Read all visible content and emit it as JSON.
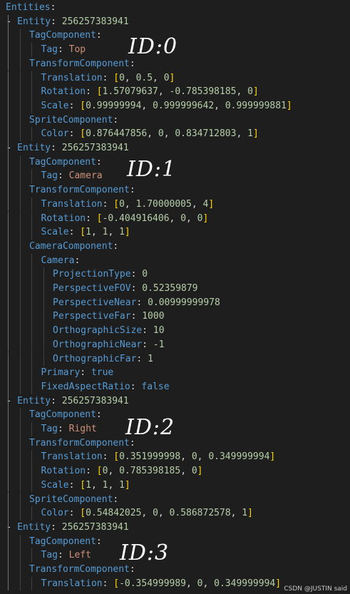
{
  "editor": {
    "lines": [
      {
        "indent": 0,
        "key": "Entities",
        "kind": "section"
      },
      {
        "indent": 1,
        "dash": true,
        "key": "Entity",
        "kind": "num",
        "value": "256257383941"
      },
      {
        "indent": 2,
        "key": "TagComponent",
        "kind": "section"
      },
      {
        "indent": 3,
        "key": "Tag",
        "kind": "str",
        "value": "Top"
      },
      {
        "indent": 2,
        "key": "TransformComponent",
        "kind": "section"
      },
      {
        "indent": 3,
        "key": "Translation",
        "kind": "arr",
        "value": [
          "0",
          "0.5",
          "0"
        ]
      },
      {
        "indent": 3,
        "key": "Rotation",
        "kind": "arr",
        "value": [
          "1.57079637",
          "-0.785398185",
          "0"
        ]
      },
      {
        "indent": 3,
        "key": "Scale",
        "kind": "arr",
        "value": [
          "0.99999994",
          "0.999999642",
          "0.999999881"
        ]
      },
      {
        "indent": 2,
        "key": "SpriteComponent",
        "kind": "section"
      },
      {
        "indent": 3,
        "key": "Color",
        "kind": "arr",
        "value": [
          "0.876447856",
          "0",
          "0.834712803",
          "1"
        ]
      },
      {
        "indent": 1,
        "dash": true,
        "key": "Entity",
        "kind": "num",
        "value": "256257383941"
      },
      {
        "indent": 2,
        "key": "TagComponent",
        "kind": "section"
      },
      {
        "indent": 3,
        "key": "Tag",
        "kind": "str",
        "value": "Camera"
      },
      {
        "indent": 2,
        "key": "TransformComponent",
        "kind": "section"
      },
      {
        "indent": 3,
        "key": "Translation",
        "kind": "arr",
        "value": [
          "0",
          "1.70000005",
          "4"
        ]
      },
      {
        "indent": 3,
        "key": "Rotation",
        "kind": "arr",
        "value": [
          "-0.404916406",
          "0",
          "0"
        ]
      },
      {
        "indent": 3,
        "key": "Scale",
        "kind": "arr",
        "value": [
          "1",
          "1",
          "1"
        ]
      },
      {
        "indent": 2,
        "key": "CameraComponent",
        "kind": "section"
      },
      {
        "indent": 3,
        "key": "Camera",
        "kind": "section"
      },
      {
        "indent": 4,
        "key": "ProjectionType",
        "kind": "num",
        "value": "0"
      },
      {
        "indent": 4,
        "key": "PerspectiveFOV",
        "kind": "num",
        "value": "0.52359879"
      },
      {
        "indent": 4,
        "key": "PerspectiveNear",
        "kind": "num",
        "value": "0.00999999978"
      },
      {
        "indent": 4,
        "key": "PerspectiveFar",
        "kind": "num",
        "value": "1000"
      },
      {
        "indent": 4,
        "key": "OrthographicSize",
        "kind": "num",
        "value": "10"
      },
      {
        "indent": 4,
        "key": "OrthographicNear",
        "kind": "num",
        "value": "-1"
      },
      {
        "indent": 4,
        "key": "OrthographicFar",
        "kind": "num",
        "value": "1"
      },
      {
        "indent": 3,
        "key": "Primary",
        "kind": "kw",
        "value": "true"
      },
      {
        "indent": 3,
        "key": "FixedAspectRatio",
        "kind": "kw",
        "value": "false"
      },
      {
        "indent": 1,
        "dash": true,
        "key": "Entity",
        "kind": "num",
        "value": "256257383941"
      },
      {
        "indent": 2,
        "key": "TagComponent",
        "kind": "section"
      },
      {
        "indent": 3,
        "key": "Tag",
        "kind": "str",
        "value": "Right"
      },
      {
        "indent": 2,
        "key": "TransformComponent",
        "kind": "section"
      },
      {
        "indent": 3,
        "key": "Translation",
        "kind": "arr",
        "value": [
          "0.351999998",
          "0",
          "0.349999994"
        ]
      },
      {
        "indent": 3,
        "key": "Rotation",
        "kind": "arr",
        "value": [
          "0",
          "0.785398185",
          "0"
        ]
      },
      {
        "indent": 3,
        "key": "Scale",
        "kind": "arr",
        "value": [
          "1",
          "1",
          "1"
        ]
      },
      {
        "indent": 2,
        "key": "SpriteComponent",
        "kind": "section"
      },
      {
        "indent": 3,
        "key": "Color",
        "kind": "arr",
        "value": [
          "0.54842025",
          "0",
          "0.586872578",
          "1"
        ]
      },
      {
        "indent": 1,
        "dash": true,
        "key": "Entity",
        "kind": "num",
        "value": "256257383941"
      },
      {
        "indent": 2,
        "key": "TagComponent",
        "kind": "section"
      },
      {
        "indent": 3,
        "key": "Tag",
        "kind": "str",
        "value": "Left"
      },
      {
        "indent": 2,
        "key": "TransformComponent",
        "kind": "section"
      },
      {
        "indent": 3,
        "key": "Translation",
        "kind": "arr",
        "value": [
          "-0.354999989",
          "0",
          "0.349999994"
        ]
      }
    ]
  },
  "annotations": [
    "ID:0",
    "ID:1",
    "ID:2",
    "ID:3"
  ],
  "watermark": "CSDN @JUSTIN said",
  "colors": {
    "background": "#1e1e1e",
    "key": "#569cd6",
    "number": "#b5cea8",
    "string": "#ce9178",
    "bracket": "#ffd700",
    "text": "#d4d4d4"
  }
}
